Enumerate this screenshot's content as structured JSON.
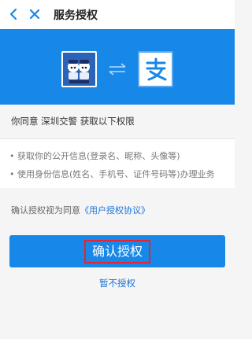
{
  "header": {
    "title": "服务授权",
    "back_icon": "chevron-left-icon",
    "close_icon": "close-icon"
  },
  "banner": {
    "background": "#1787e8",
    "left_logo_icon": "traffic-police-mascot-logo",
    "exchange_icon": "exchange-arrows-icon",
    "right_logo_icon": "alipay-logo-icon"
  },
  "consent": {
    "text": "你同意 深圳交警 获取以下权限"
  },
  "permissions": {
    "items": [
      "• 获取你的公开信息(登录名、昵称、头像等)",
      "• 使用身份信息(姓名、手机号、证件号码等)办理业务"
    ]
  },
  "agreement": {
    "prefix": "确认授权视为同意",
    "link": "《用户授权协议》"
  },
  "actions": {
    "confirm_label": "确认授权",
    "decline_label": "暂不授权"
  },
  "colors": {
    "accent": "#1787e8",
    "link": "#1a73d8",
    "highlight": "#e8222e"
  }
}
